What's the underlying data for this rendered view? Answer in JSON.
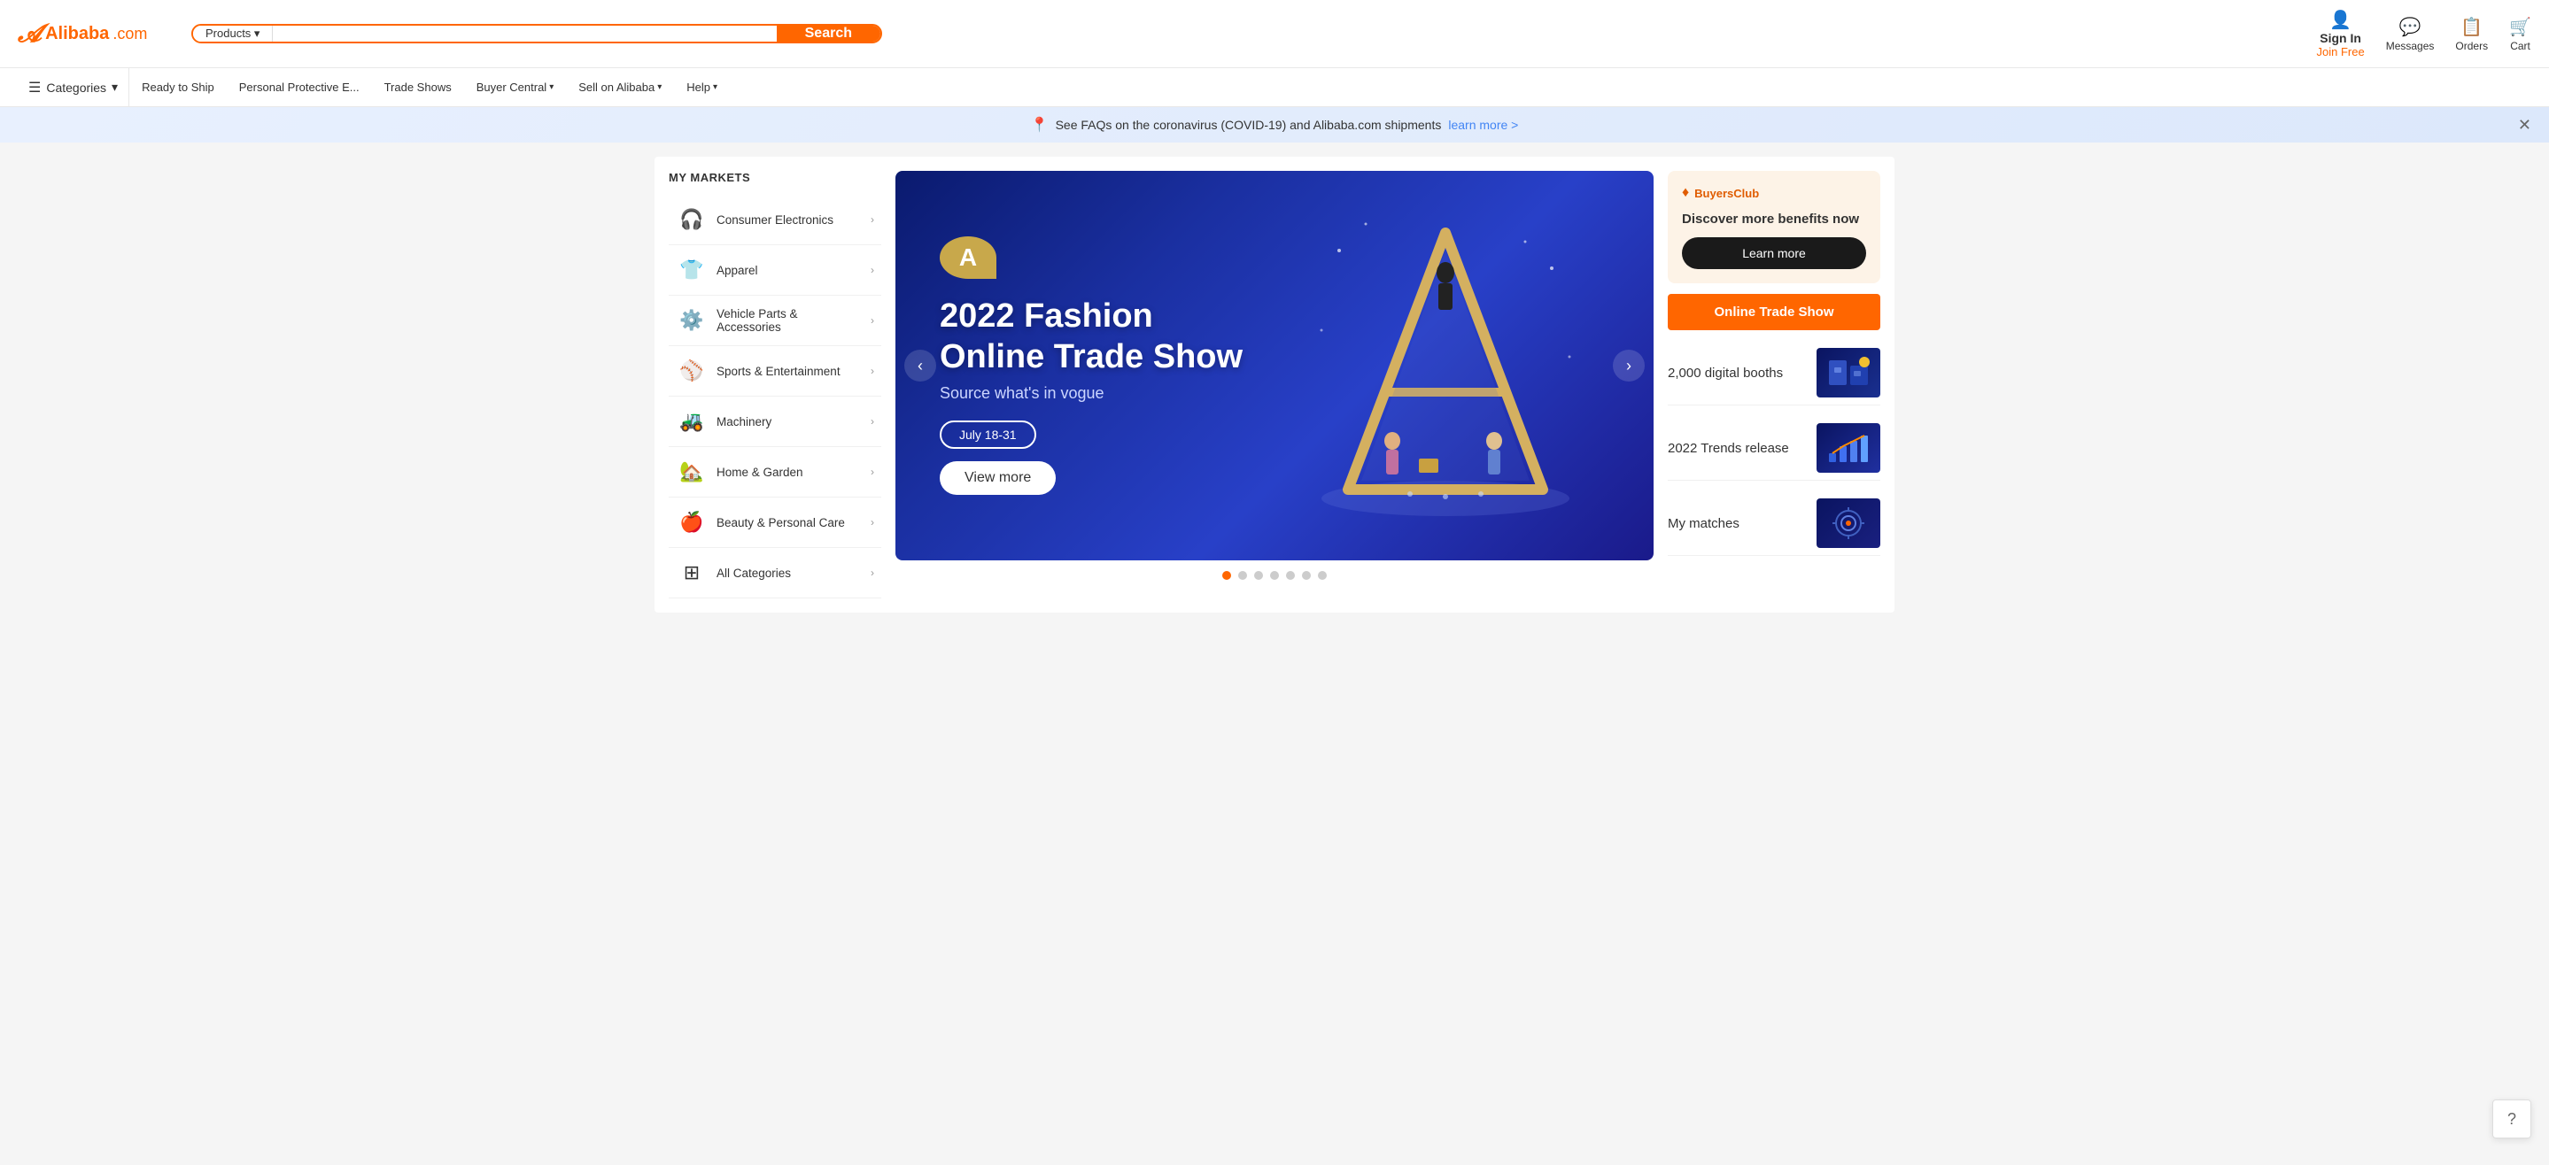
{
  "header": {
    "logo_text": "Alibaba",
    "logo_dotcom": ".com",
    "search_products_label": "Products ▾",
    "search_placeholder": "",
    "search_btn_label": "Search",
    "sign_in_label": "Sign In",
    "join_free_label": "Join Free",
    "messages_label": "Messages",
    "orders_label": "Orders",
    "cart_label": "Cart"
  },
  "navbar": {
    "categories_label": "Categories",
    "items": [
      {
        "label": "Ready to Ship",
        "has_arrow": false
      },
      {
        "label": "Personal Protective E...",
        "has_arrow": false
      },
      {
        "label": "Trade Shows",
        "has_arrow": false
      },
      {
        "label": "Buyer Central",
        "has_arrow": true
      },
      {
        "label": "Sell on Alibaba",
        "has_arrow": true
      },
      {
        "label": "Help",
        "has_arrow": true
      }
    ]
  },
  "announcement": {
    "text": "See FAQs on the coronavirus (COVID-19) and Alibaba.com shipments",
    "link_text": "learn more >"
  },
  "sidebar": {
    "title": "MY MARKETS",
    "items": [
      {
        "label": "Consumer Electronics",
        "icon": "🎧"
      },
      {
        "label": "Apparel",
        "icon": "👕"
      },
      {
        "label": "Vehicle Parts & Accessories",
        "icon": "⚙️"
      },
      {
        "label": "Sports & Entertainment",
        "icon": "⚾"
      },
      {
        "label": "Machinery",
        "icon": "🚜"
      },
      {
        "label": "Home & Garden",
        "icon": "🏠"
      },
      {
        "label": "Beauty & Personal Care",
        "icon": "🍎"
      },
      {
        "label": "All Categories",
        "icon": "⊞"
      }
    ]
  },
  "banner": {
    "logo_letter": "A",
    "title_line1": "2022 Fashion",
    "title_line2": "Online Trade Show",
    "subtitle": "Source what's in vogue",
    "date": "July 18-31",
    "view_more": "View more"
  },
  "banner_dots": {
    "count": 7,
    "active_index": 0
  },
  "buyers_club": {
    "icon_label": "♦",
    "brand": "BuyersClub",
    "title": "Discover more benefits now",
    "button_label": "Learn more"
  },
  "trade_show": {
    "button_label": "Online Trade Show"
  },
  "right_items": [
    {
      "label": "2,000 digital booths"
    },
    {
      "label": "2022 Trends release"
    },
    {
      "label": "My matches"
    }
  ],
  "help": {
    "icon": "?"
  }
}
